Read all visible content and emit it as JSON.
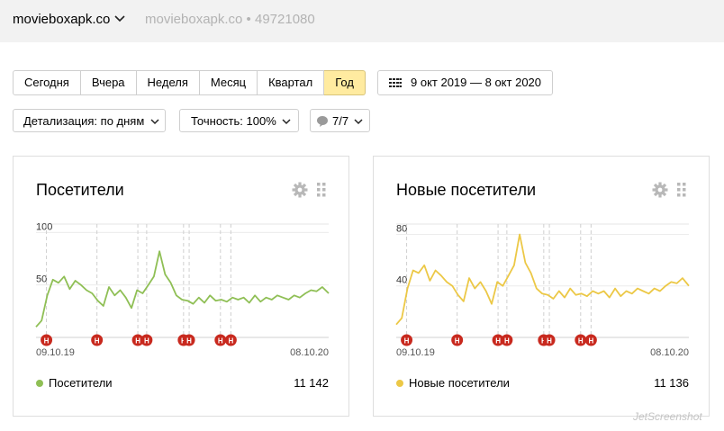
{
  "header": {
    "site": "movieboxapk.co",
    "counter_caption": "movieboxapk.co • 49721080"
  },
  "period_tabs": [
    {
      "label": "Сегодня"
    },
    {
      "label": "Вчера"
    },
    {
      "label": "Неделя"
    },
    {
      "label": "Месяц"
    },
    {
      "label": "Квартал"
    },
    {
      "label": "Год",
      "active": true
    }
  ],
  "date_range": "9 окт 2019 — 8 окт 2020",
  "controls": {
    "detail": "Детализация: по дням",
    "accuracy": "Точность: 100%",
    "notes": "7/7"
  },
  "colors": {
    "active_tab": "#ffeba0",
    "series_green": "#8fbf55",
    "series_yellow": "#ecc846",
    "note_marker": "#c8291e"
  },
  "icons": {
    "site_dropdown": "chevron-down-icon",
    "date_picker": "calendar-icon",
    "notes": "speech-bubble-icon",
    "card_settings": "gear-icon",
    "card_drag": "drag-handle-icon"
  },
  "chart_data": [
    {
      "type": "line",
      "title": "Посетители",
      "ylim": [
        0,
        108
      ],
      "yticks": [
        "100",
        "50"
      ],
      "ytick_values": [
        100,
        50
      ],
      "x_start_label": "09.10.19",
      "x_end_label": "08.10.20",
      "x": [
        "2019-10-09",
        "2019-10-16",
        "2019-10-23",
        "2019-10-30",
        "2019-11-06",
        "2019-11-13",
        "2019-11-20",
        "2019-11-27",
        "2019-12-04",
        "2019-12-11",
        "2019-12-18",
        "2019-12-25",
        "2020-01-01",
        "2020-01-08",
        "2020-01-15",
        "2020-01-22",
        "2020-01-29",
        "2020-02-05",
        "2020-02-12",
        "2020-02-19",
        "2020-02-26",
        "2020-03-04",
        "2020-03-11",
        "2020-03-18",
        "2020-03-25",
        "2020-04-01",
        "2020-04-08",
        "2020-04-15",
        "2020-04-22",
        "2020-04-29",
        "2020-05-06",
        "2020-05-13",
        "2020-05-20",
        "2020-05-27",
        "2020-06-03",
        "2020-06-10",
        "2020-06-17",
        "2020-06-24",
        "2020-07-01",
        "2020-07-08",
        "2020-07-15",
        "2020-07-22",
        "2020-07-29",
        "2020-08-05",
        "2020-08-12",
        "2020-08-19",
        "2020-08-26",
        "2020-09-02",
        "2020-09-09",
        "2020-09-16",
        "2020-09-23",
        "2020-09-30",
        "2020-10-08"
      ],
      "series": [
        {
          "name": "Посетители",
          "color": "#8fbf55",
          "values": [
            10,
            16,
            40,
            55,
            52,
            58,
            46,
            54,
            50,
            45,
            42,
            35,
            30,
            48,
            40,
            45,
            38,
            28,
            45,
            42,
            50,
            58,
            82,
            60,
            52,
            40,
            36,
            35,
            32,
            38,
            33,
            40,
            35,
            36,
            34,
            38,
            36,
            38,
            33,
            40,
            34,
            38,
            36,
            40,
            38,
            36,
            40,
            38,
            42,
            45,
            44,
            48,
            42
          ]
        }
      ],
      "legend": {
        "label": "Посетители",
        "total": "11 142"
      },
      "annotations": [
        {
          "date": "2019-10-22",
          "label": "Н"
        },
        {
          "date": "2019-12-24",
          "label": "Н"
        },
        {
          "date": "2020-02-13",
          "label": "Н"
        },
        {
          "date": "2020-02-24",
          "label": "Н"
        },
        {
          "date": "2020-04-10",
          "label": "Н"
        },
        {
          "date": "2020-04-17",
          "label": "Н"
        },
        {
          "date": "2020-05-26",
          "label": "Н"
        },
        {
          "date": "2020-06-08",
          "label": "Н"
        }
      ]
    },
    {
      "type": "line",
      "title": "Новые посетители",
      "ylim": [
        0,
        88
      ],
      "yticks": [
        "80",
        "40"
      ],
      "ytick_values": [
        80,
        40
      ],
      "x_start_label": "09.10.19",
      "x_end_label": "08.10.20",
      "x": [
        "2019-10-09",
        "2019-10-16",
        "2019-10-23",
        "2019-10-30",
        "2019-11-06",
        "2019-11-13",
        "2019-11-20",
        "2019-11-27",
        "2019-12-04",
        "2019-12-11",
        "2019-12-18",
        "2019-12-25",
        "2020-01-01",
        "2020-01-08",
        "2020-01-15",
        "2020-01-22",
        "2020-01-29",
        "2020-02-05",
        "2020-02-12",
        "2020-02-19",
        "2020-02-26",
        "2020-03-04",
        "2020-03-11",
        "2020-03-18",
        "2020-03-25",
        "2020-04-01",
        "2020-04-08",
        "2020-04-15",
        "2020-04-22",
        "2020-04-29",
        "2020-05-06",
        "2020-05-13",
        "2020-05-20",
        "2020-05-27",
        "2020-06-03",
        "2020-06-10",
        "2020-06-17",
        "2020-06-24",
        "2020-07-01",
        "2020-07-08",
        "2020-07-15",
        "2020-07-22",
        "2020-07-29",
        "2020-08-05",
        "2020-08-12",
        "2020-08-19",
        "2020-08-26",
        "2020-09-02",
        "2020-09-09",
        "2020-09-16",
        "2020-09-23",
        "2020-09-30",
        "2020-10-08"
      ],
      "series": [
        {
          "name": "Новые посетители",
          "color": "#ecc846",
          "values": [
            10,
            15,
            38,
            52,
            50,
            56,
            44,
            52,
            48,
            43,
            40,
            33,
            28,
            46,
            38,
            43,
            36,
            26,
            43,
            40,
            48,
            56,
            80,
            58,
            50,
            38,
            34,
            33,
            30,
            36,
            31,
            38,
            33,
            34,
            32,
            36,
            34,
            36,
            31,
            38,
            32,
            36,
            34,
            38,
            36,
            34,
            38,
            36,
            40,
            43,
            42,
            46,
            40
          ]
        }
      ],
      "legend": {
        "label": "Новые посетители",
        "total": "11 136"
      },
      "annotations": [
        {
          "date": "2019-10-22",
          "label": "Н"
        },
        {
          "date": "2019-12-24",
          "label": "Н"
        },
        {
          "date": "2020-02-13",
          "label": "Н"
        },
        {
          "date": "2020-02-24",
          "label": "Н"
        },
        {
          "date": "2020-04-10",
          "label": "Н"
        },
        {
          "date": "2020-04-17",
          "label": "Н"
        },
        {
          "date": "2020-05-26",
          "label": "Н"
        },
        {
          "date": "2020-06-08",
          "label": "Н"
        }
      ]
    }
  ],
  "watermark": "JetScreenshot"
}
